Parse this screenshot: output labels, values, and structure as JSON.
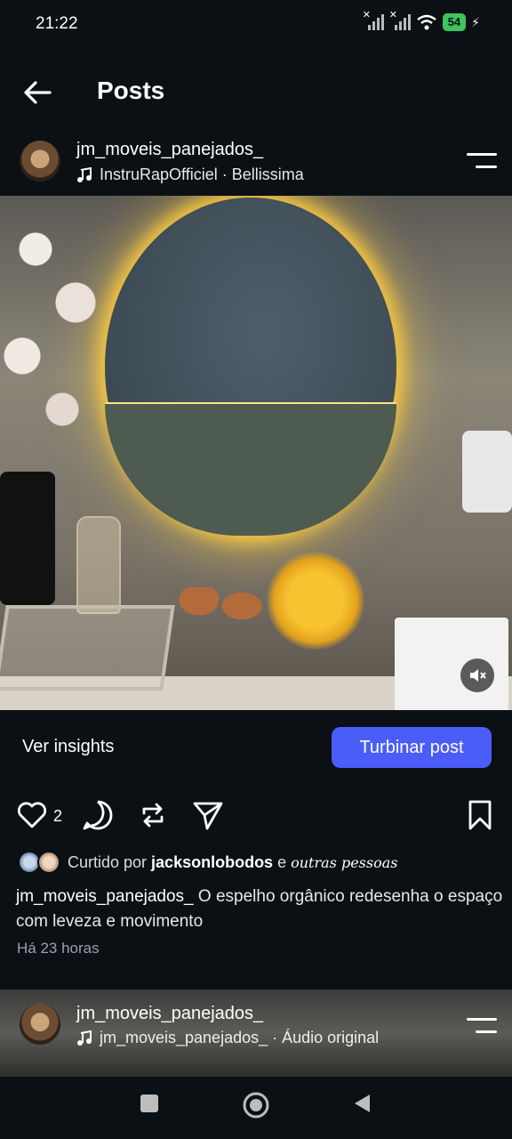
{
  "status_bar": {
    "time": "21:22",
    "battery": "54"
  },
  "header": {
    "title": "Posts"
  },
  "post": {
    "username": "jm_moveis_panejados_",
    "audio": "InstruRapOfficiel · Bellissima",
    "insights_label": "Ver insights",
    "boost_label": "Turbinar post",
    "like_count": "2",
    "liked_by_prefix": "Curtido por ",
    "liked_by_user": "jacksonlobodos",
    "liked_by_connector": " e ",
    "liked_by_others": "outras pessoas",
    "caption_user": "jm_moveis_panejados_",
    "caption_text": " O espelho orgânico redesenha o espaço com leveza e movimento",
    "time_ago": "Há 23 horas"
  },
  "next_post": {
    "username": "jm_moveis_panejados_",
    "audio": "jm_moveis_panejados_ · Áudio original"
  },
  "icons": {
    "back": "arrow-left",
    "menu": "options-lines",
    "like": "heart",
    "comment": "speech-bubble",
    "repost": "repost-arrows",
    "share": "send-triangle",
    "save": "bookmark",
    "music": "music-note",
    "mute": "speaker-muted"
  },
  "colors": {
    "background": "#0b1014",
    "accent": "#4a5df9",
    "battery": "#3ec35f"
  }
}
